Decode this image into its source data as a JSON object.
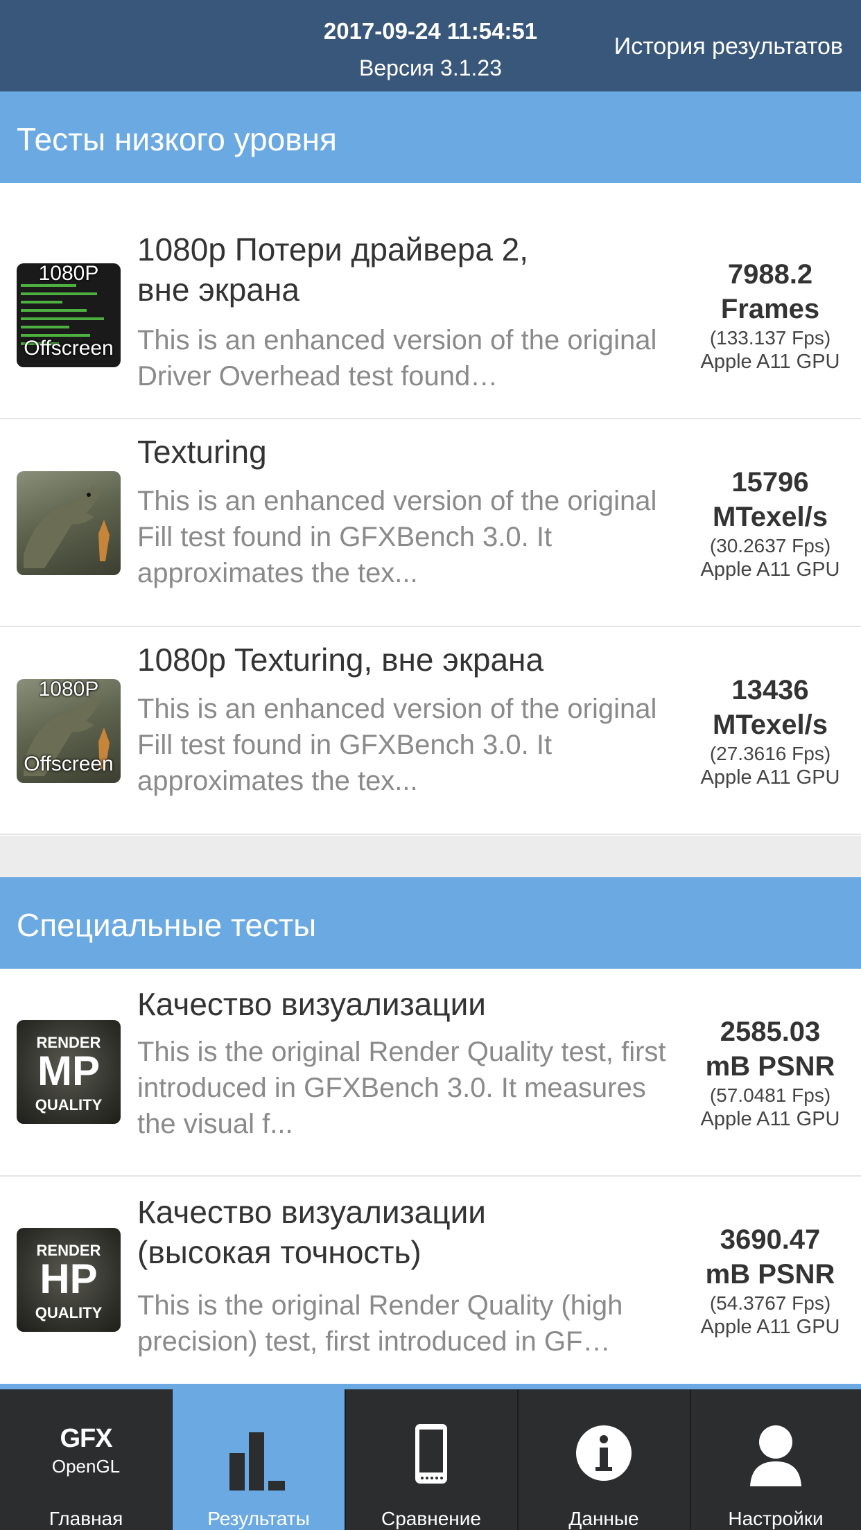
{
  "header": {
    "datetime": "2017-09-24 11:54:51",
    "version": "Версия 3.1.23",
    "history_link": "История результатов"
  },
  "sections": [
    {
      "title": "Тесты низкого уровня",
      "tests": [
        {
          "thumb": "driver-overhead-offscreen",
          "thumb_top": "1080P",
          "thumb_bottom": "Offscreen",
          "title": "1080p Потери драйвера 2,\nвне экрана",
          "desc": "This is an enhanced version of the original Driver Overhead test found…",
          "score": "7988.2",
          "unit": "Frames",
          "fps": "(133.137 Fps)",
          "gpu": "Apple A11 GPU"
        },
        {
          "thumb": "texturing",
          "title": "Texturing",
          "desc": "This is an enhanced version of the original Fill test found in GFXBench 3.0. It approximates the tex...",
          "score": "15796",
          "unit": "MTexel/s",
          "fps": "(30.2637 Fps)",
          "gpu": "Apple A11 GPU"
        },
        {
          "thumb": "texturing-offscreen",
          "thumb_top": "1080P",
          "thumb_bottom": "Offscreen",
          "title": "1080p Texturing, вне экрана",
          "desc": "This is an enhanced version of the original Fill test found in GFXBench 3.0. It approximates the tex...",
          "score": "13436",
          "unit": "MTexel/s",
          "fps": "(27.3616 Fps)",
          "gpu": "Apple A11 GPU"
        }
      ]
    },
    {
      "title": "Специальные тесты",
      "tests": [
        {
          "thumb": "render-quality-mp",
          "thumb_top": "RENDER",
          "thumb_mid": "MP",
          "thumb_bottom": "QUALITY",
          "title": "Качество визуализации",
          "desc": "This is the original Render Quality test, first introduced in GFXBench 3.0. It measures the visual f...",
          "score": "2585.03",
          "unit": "mB PSNR",
          "fps": "(57.0481 Fps)",
          "gpu": "Apple A11 GPU"
        },
        {
          "thumb": "render-quality-hp",
          "thumb_top": "RENDER",
          "thumb_mid": "HP",
          "thumb_bottom": "QUALITY",
          "title": "Качество визуализации\n(высокая точность)",
          "desc": "This is the original Render Quality (high precision) test, first introduced in GF…",
          "score": "3690.47",
          "unit": "mB PSNR",
          "fps": "(54.3767 Fps)",
          "gpu": "Apple A11 GPU"
        }
      ]
    }
  ],
  "tabbar": {
    "home_logo_main": "GFX",
    "home_logo_sub": "OpenGL",
    "tabs": [
      "Главная",
      "Результаты",
      "Сравнение",
      "Данные",
      "Настройки"
    ],
    "active": "Результаты"
  },
  "colors": {
    "topbar": "#38577a",
    "section_header": "#6aa9e1",
    "tabbar": "#2b2d2f",
    "active_tab": "#6aa9e1"
  }
}
